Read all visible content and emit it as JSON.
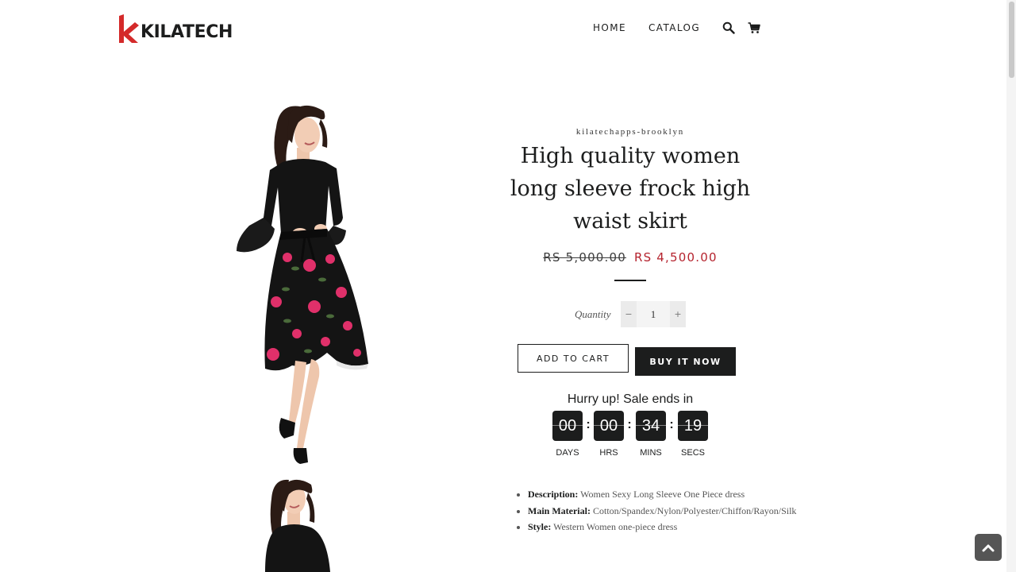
{
  "header": {
    "logo_text": "KILATECH",
    "nav": [
      {
        "label": "HOME"
      },
      {
        "label": "CATALOG"
      }
    ],
    "icons": [
      "search-icon",
      "cart-icon"
    ]
  },
  "product": {
    "vendor": "kilatechapps-brooklyn",
    "title_lines": [
      "High quality women",
      "long sleeve frock high",
      "waist skirt"
    ],
    "compare_price": "RS 5,000.00",
    "sale_price": "RS 4,500.00",
    "quantity_label": "Quantity",
    "quantity_value": "1",
    "quantity_minus": "−",
    "quantity_plus": "+",
    "add_to_cart_label": "ADD TO CART",
    "buy_now_label": "BUY IT NOW"
  },
  "timer": {
    "heading": "Hurry up! Sale ends in",
    "separator": ":",
    "units": [
      {
        "value": "00",
        "label": "DAYS"
      },
      {
        "value": "00",
        "label": "HRS"
      },
      {
        "value": "34",
        "label": "MINS"
      },
      {
        "value": "19",
        "label": "SECS"
      }
    ]
  },
  "description": {
    "items": [
      {
        "key": "Description:",
        "value": "Women Sexy Long Sleeve One Piece dress"
      },
      {
        "key": "Main Material:",
        "value": "Cotton/Spandex/Nylon/Polyester/Chiffon/Rayon/Silk"
      },
      {
        "key": "Style:",
        "value": "Western Women one-piece dress"
      }
    ]
  },
  "colors": {
    "accent": "#1c1d1d",
    "sale": "#b5232e",
    "logo_red": "#d42a2a"
  }
}
